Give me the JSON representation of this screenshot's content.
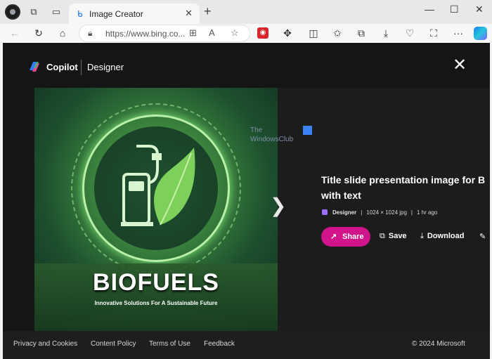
{
  "browser": {
    "tab": {
      "title": "Image Creator",
      "icon": "bing-b-icon"
    },
    "address": {
      "url": "https://www.bing.co..."
    }
  },
  "header": {
    "brand": "Copilot",
    "product": "Designer"
  },
  "image": {
    "headline": "BIOFUELS",
    "tagline": "Innovative Solutions For A Sustainable Future"
  },
  "watermark": {
    "line1": "The",
    "line2": "WindowsClub"
  },
  "details": {
    "title_line1": "Title slide presentation image for B",
    "title_line2": "with text",
    "source": "Designer",
    "dimensions": "1024 × 1024 jpg",
    "age": "1 hr ago"
  },
  "actions": {
    "share": "Share",
    "save": "Save",
    "download": "Download"
  },
  "footer": {
    "links": [
      "Privacy and Cookies",
      "Content Policy",
      "Terms of Use",
      "Feedback"
    ],
    "copyright": "© 2024 Microsoft"
  },
  "colors": {
    "share_button": "#d1148a",
    "page_background": "#151515",
    "footer_background": "#1e1e1e"
  }
}
